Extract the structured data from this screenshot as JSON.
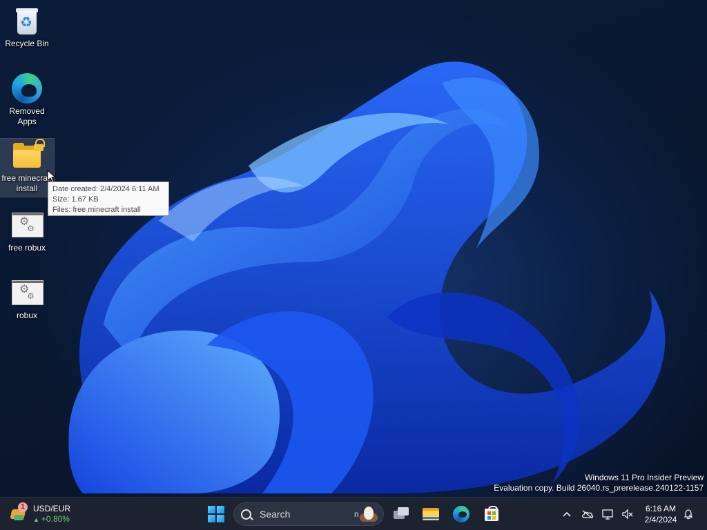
{
  "desktop": {
    "icons": [
      {
        "label": "Recycle Bin",
        "icon": "recycle-bin-icon"
      },
      {
        "label": "Removed Apps",
        "icon": "edge-icon"
      },
      {
        "label": "free minecraft install",
        "icon": "locked-folder-icon"
      },
      {
        "label": "free robux",
        "icon": "settings-file-icon"
      },
      {
        "label": "robux",
        "icon": "settings-file-icon"
      }
    ],
    "tooltip": {
      "date_created": "Date created: 2/4/2024 6:11 AM",
      "size": "Size: 1.67 KB",
      "files": "Files: free minecraft install"
    },
    "watermark": {
      "line1": "Windows 11 Pro Insider Preview",
      "line2": "Evaluation copy. Build 26040.rs_prerelease.240122-1157"
    }
  },
  "taskbar": {
    "widget": {
      "badge": "1",
      "title": "USD/EUR",
      "change": "+0.80%"
    },
    "search": {
      "placeholder": "Search"
    },
    "pinned": [
      "task-view",
      "file-explorer",
      "microsoft-edge",
      "microsoft-store"
    ],
    "tray": {
      "chevron": "^",
      "time": "6:16 AM",
      "date": "2/4/2024"
    }
  },
  "colors": {
    "accent": "#1f6bff",
    "taskbar": "#1c2230",
    "change_positive": "#6fd36f",
    "tooltip_bg": "#f9f9f9"
  }
}
